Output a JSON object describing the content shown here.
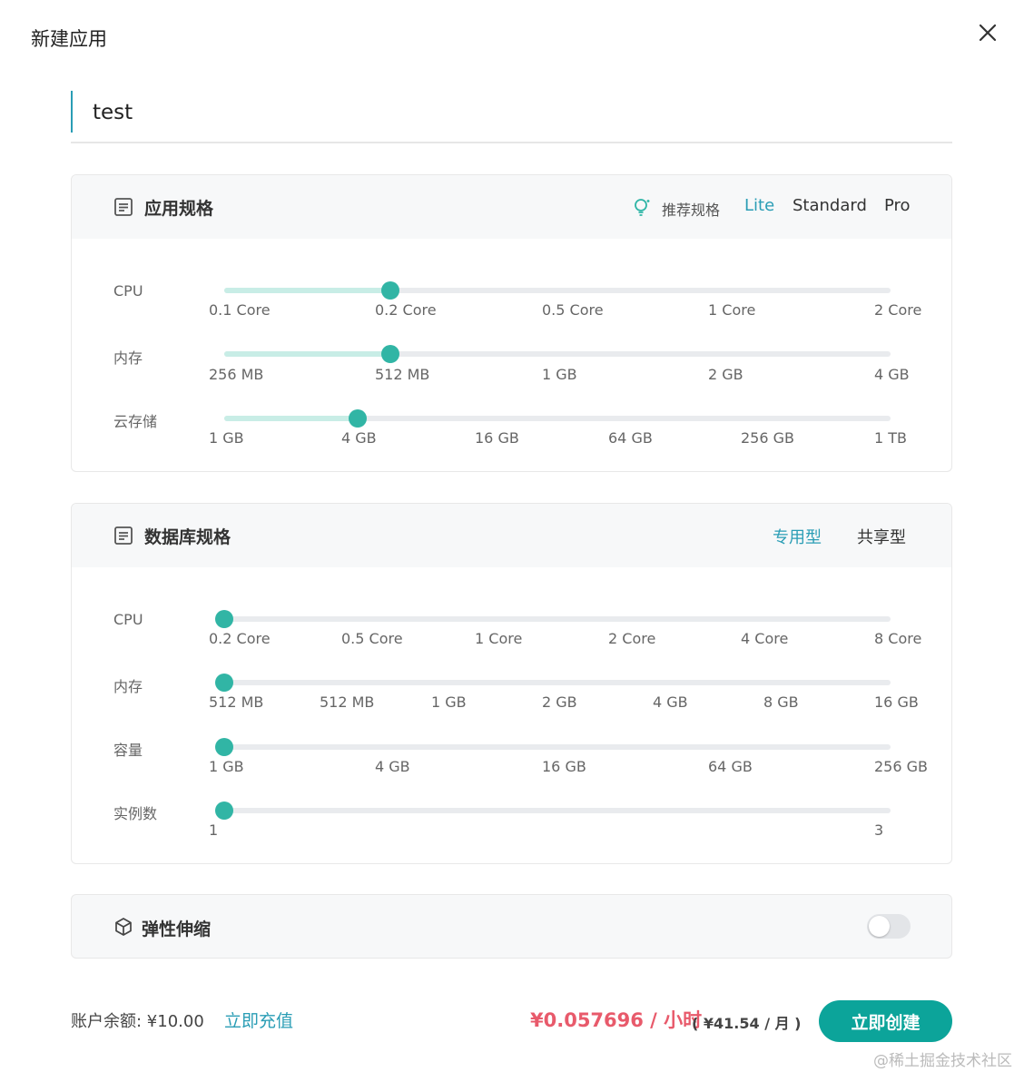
{
  "dialog": {
    "title": "新建应用",
    "close_icon": "close-icon"
  },
  "name_field": {
    "value": "test"
  },
  "app_spec": {
    "title": "应用规格",
    "recommend_label": "推荐规格",
    "presets": [
      "Lite",
      "Standard",
      "Pro"
    ],
    "active_preset": "Lite",
    "accent": "#2a9db5",
    "rows": [
      {
        "label": "CPU",
        "ticks": [
          "0.1 Core",
          "0.2 Core",
          "0.5 Core",
          "1 Core",
          "2 Core"
        ],
        "selected": "0.2 Core"
      },
      {
        "label": "内存",
        "ticks": [
          "256 MB",
          "512 MB",
          "1 GB",
          "2 GB",
          "4 GB"
        ],
        "selected": "512 MB"
      },
      {
        "label": "云存储",
        "ticks": [
          "1 GB",
          "4 GB",
          "16 GB",
          "64 GB",
          "256 GB",
          "1 TB"
        ],
        "selected": "4 GB"
      }
    ]
  },
  "db_spec": {
    "title": "数据库规格",
    "types": [
      "专用型",
      "共享型"
    ],
    "active_type": "专用型",
    "rows": [
      {
        "label": "CPU",
        "ticks": [
          "0.2 Core",
          "0.5 Core",
          "1 Core",
          "2 Core",
          "4 Core",
          "8 Core"
        ],
        "selected": "0.2 Core"
      },
      {
        "label": "内存",
        "ticks": [
          "512 MB",
          "512 MB",
          "1 GB",
          "2 GB",
          "4 GB",
          "8 GB",
          "16 GB"
        ],
        "selected": "512 MB"
      },
      {
        "label": "容量",
        "ticks": [
          "1 GB",
          "4 GB",
          "16 GB",
          "64 GB",
          "256 GB"
        ],
        "selected": "1 GB"
      },
      {
        "label": "实例数",
        "ticks": [
          "1",
          "3"
        ],
        "selected": "1"
      }
    ]
  },
  "autoscale": {
    "title": "弹性伸缩",
    "enabled": false
  },
  "footer": {
    "balance": "账户余额: ¥10.00",
    "recharge": "立即充值",
    "price_hour": "¥0.057696 / 小时",
    "price_month": "( ¥41.54 / 月 )",
    "create": "立即创建"
  },
  "watermark": "@稀土掘金技术社区",
  "colors": {
    "accent": "#2a9db5",
    "slider": "#31b5a5",
    "slider_fill": "#c8ede6",
    "price": "#e85a6b",
    "primary_button": "#0ca49a"
  }
}
